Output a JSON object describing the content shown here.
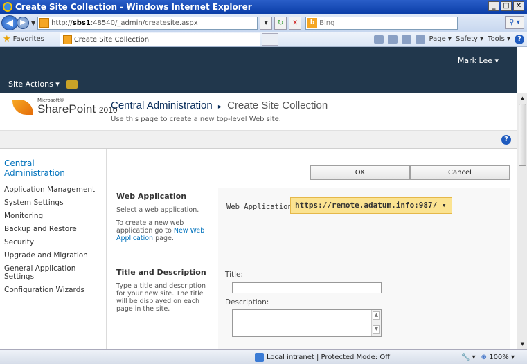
{
  "browser": {
    "window_title": "Create Site Collection - Windows Internet Explorer",
    "url_prefix": "http://",
    "url_host": "sbs1",
    "url_rest": ":48540/_admin/createsite.aspx",
    "search_placeholder": "Bing",
    "favorites_label": "Favorites",
    "tab_title": "Create Site Collection",
    "cmd_page": "Page ▾",
    "cmd_safety": "Safety ▾",
    "cmd_tools": "Tools ▾"
  },
  "ribbon": {
    "site_actions": "Site Actions ▾",
    "user": "Mark Lee ▾"
  },
  "header": {
    "logo_ms": "Microsoft®",
    "logo_name": "SharePoint",
    "logo_year": "2010",
    "breadcrumb_root": "Central Administration",
    "breadcrumb_sep": "▸",
    "breadcrumb_current": "Create Site Collection",
    "description": "Use this page to create a new top-level Web site."
  },
  "leftnav": {
    "title": "Central Administration",
    "items": [
      "Application Management",
      "System Settings",
      "Monitoring",
      "Backup and Restore",
      "Security",
      "Upgrade and Migration",
      "General Application Settings",
      "Configuration Wizards"
    ]
  },
  "buttons": {
    "ok": "OK",
    "cancel": "Cancel"
  },
  "web_application": {
    "heading": "Web Application",
    "text1": "Select a web application.",
    "text2_prefix": "To create a new web application go to ",
    "text2_link": "New Web Application",
    "text2_suffix": " page.",
    "field_label": "Web Application:",
    "selected_value": "https://remote.adatum.info:987/ ▾"
  },
  "title_description": {
    "heading": "Title and Description",
    "text": "Type a title and description for your new site. The title will be displayed on each page in the site.",
    "title_label": "Title:",
    "title_value": "",
    "description_label": "Description:",
    "description_value": ""
  },
  "statusbar": {
    "zone": "Local intranet | Protected Mode: Off",
    "zoom": "100%"
  },
  "colors": {
    "ribbon": "#21374c",
    "link": "#0072bc",
    "select_highlight": "#fbe391"
  }
}
